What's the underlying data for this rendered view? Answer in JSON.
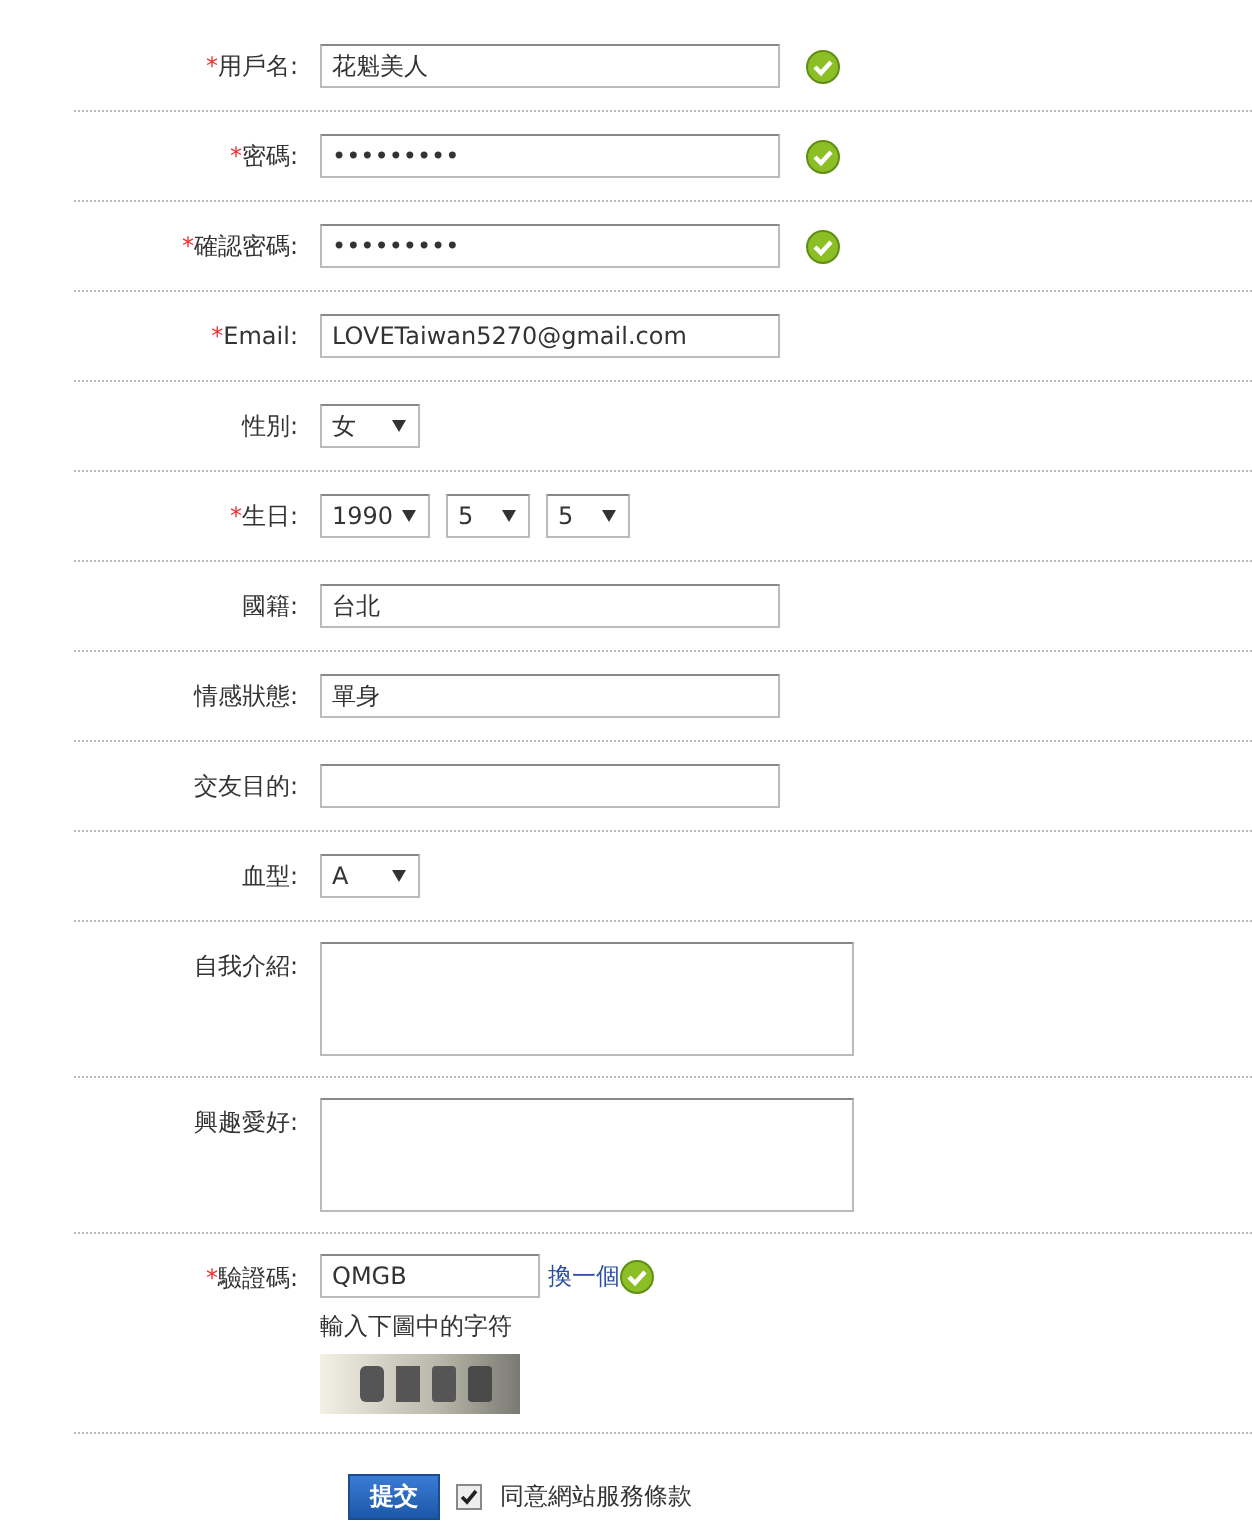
{
  "form": {
    "rows": [
      {
        "kind": "text",
        "label": "用戶名:",
        "required_mark": "*",
        "value": "花魁美人",
        "valid": true
      },
      {
        "kind": "text",
        "label": "密碼:",
        "required_mark": "*",
        "value": "•••••••••",
        "valid": true
      },
      {
        "kind": "text",
        "label": "確認密碼:",
        "required_mark": "*",
        "value": "•••••••••",
        "valid": true
      },
      {
        "kind": "text",
        "label": "Email:",
        "required_mark": "*",
        "value": "LOVETaiwan5270@gmail.com",
        "valid": false
      },
      {
        "kind": "select",
        "label": "性別:",
        "selects": [
          "女"
        ]
      },
      {
        "kind": "select",
        "label": "生日:",
        "required_mark": "*",
        "selects": [
          "1990",
          "5",
          "5"
        ]
      },
      {
        "kind": "text",
        "label": "國籍:",
        "value": "台北",
        "valid": false
      },
      {
        "kind": "text",
        "label": "情感狀態:",
        "value": "單身",
        "valid": false
      },
      {
        "kind": "text",
        "label": "交友目的:",
        "value": "",
        "valid": false
      },
      {
        "kind": "select",
        "label": "血型:",
        "selects": [
          "A"
        ]
      },
      {
        "kind": "textarea",
        "label": "自我介紹:"
      },
      {
        "kind": "textarea",
        "label": "興趣愛好:"
      },
      {
        "kind": "captcha",
        "label": "驗證碼:",
        "required_mark": "*",
        "value": "QMGB",
        "refresh": "換一個",
        "valid": true,
        "hint": "輸入下圖中的字符"
      }
    ],
    "submit": "提交",
    "agree": {
      "label": "同意網站服務條款",
      "checked": true
    }
  }
}
